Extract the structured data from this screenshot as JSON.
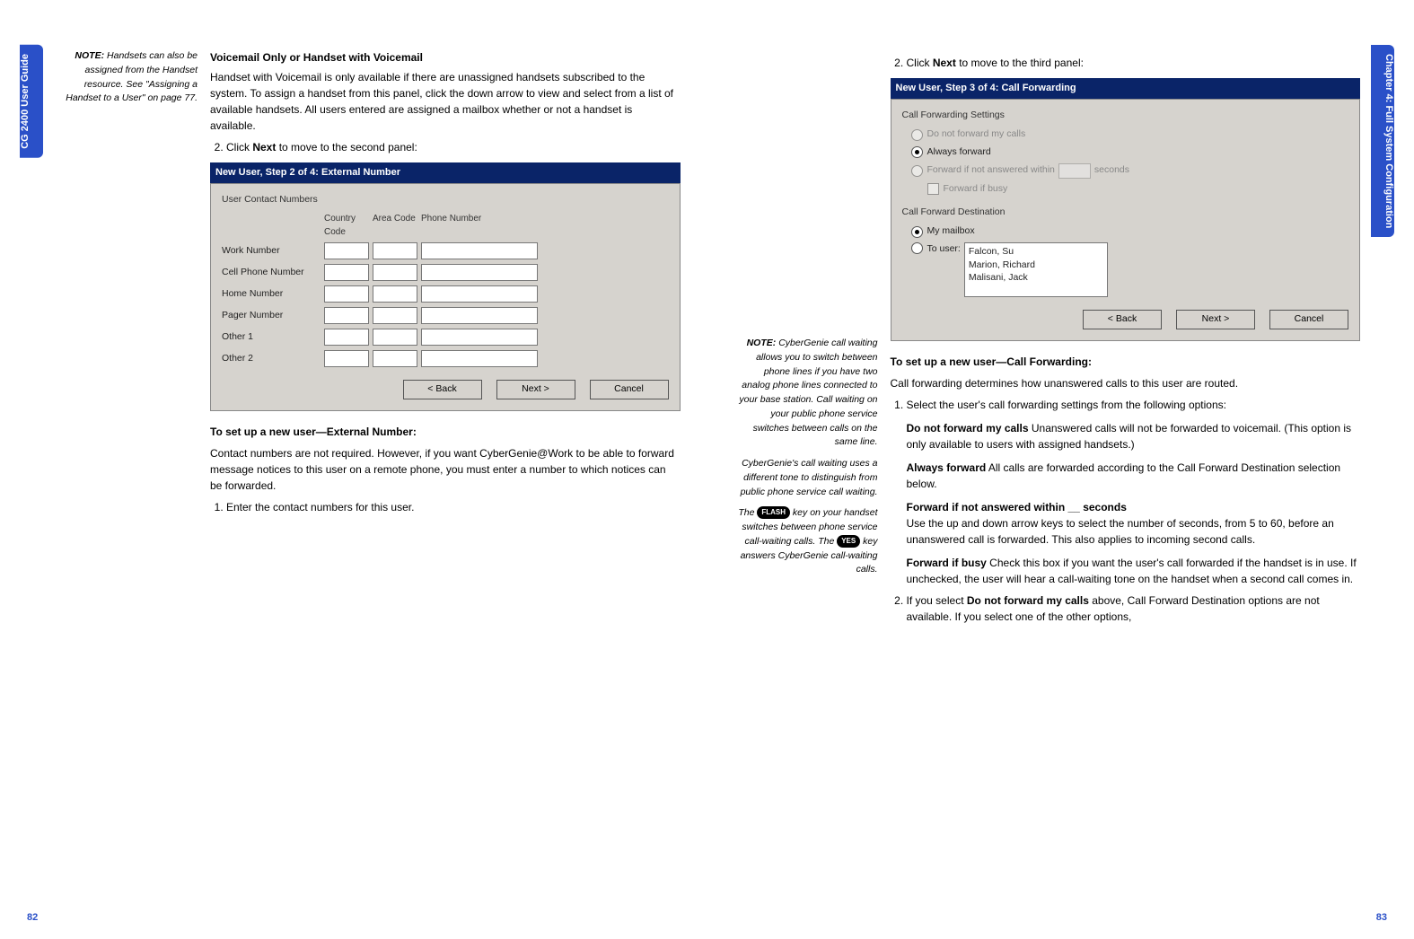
{
  "leftTab": "CG 2400 User Guide",
  "rightTab": "Chapter 4: Full System Configuration",
  "leftPage": {
    "note": {
      "label": "NOTE:",
      "text": "Handsets can also be assigned from the Handset resource. See \"Assigning a Handset to a User\" on page 77."
    },
    "h1": "Voicemail Only or Handset with Voicemail",
    "p1": "Handset with Voicemail is only available if there are unassigned handsets subscribed to the system. To assign a handset from this panel, click the down arrow to view and select from a list of available handsets. All users entered are assigned a mailbox whether or not a handset is available.",
    "step2": "Click ",
    "step2b": "Next",
    "step2c": " to move to the second panel:",
    "dialog1": {
      "title": "New User, Step 2 of 4: External Number",
      "group": "User Contact Numbers",
      "colCountry": "Country Code",
      "colArea": "Area Code",
      "colPhone": "Phone Number",
      "rows": [
        "Work Number",
        "Cell Phone Number",
        "Home Number",
        "Pager Number",
        "Other 1",
        "Other 2"
      ],
      "back": "< Back",
      "next": "Next >",
      "cancel": "Cancel"
    },
    "h2": "To set up a new user—External Number:",
    "p2": "Contact numbers are not required. However, if you want CyberGenie@Work to be able to forward message notices to this user on a remote phone, you must enter a number to which notices can be forwarded.",
    "step1b": "Enter the contact numbers for this user.",
    "pageNum": "82"
  },
  "rightPage": {
    "step2a": "Click ",
    "step2b": "Next",
    "step2c": " to move to the third panel:",
    "dialog2": {
      "title": "New User, Step 3 of 4: Call Forwarding",
      "group1": "Call Forwarding Settings",
      "opt1": "Do not forward my calls",
      "opt2": "Always forward",
      "opt3a": "Forward if not answered within",
      "opt3b": "seconds",
      "opt3chk": "Forward if busy",
      "group2": "Call Forward Destination",
      "opt4": "My mailbox",
      "opt5": "To user:",
      "listItems": [
        "Falcon, Su",
        "Marion, Richard",
        "Malisani, Jack"
      ],
      "back": "< Back",
      "next": "Next >",
      "cancel": "Cancel"
    },
    "note": {
      "label": "NOTE:",
      "text1": "CyberGenie call waiting allows you to switch between phone lines if you have two analog phone lines connected to your base station. Call waiting on your public phone service switches between calls on the same line.",
      "text2": "CyberGenie's call waiting uses a different tone to distinguish from public phone service call waiting.",
      "text3a": "The ",
      "key1": "FLASH",
      "text3b": " key on your handset switches between phone service call-waiting calls. The ",
      "key2": "YES",
      "text3c": " key answers CyberGenie call-waiting calls."
    },
    "h1": "To set up a new user—Call Forwarding:",
    "p1": "Call forwarding determines how unanswered calls to this user are routed.",
    "li1": "Select the user's call forwarding settings from the following options:",
    "d1t": "Do not forward my calls",
    "d1d": "  Unanswered calls will not be forwarded to voicemail. (This option is only available to users with assigned handsets.)",
    "d2t": "Always forward",
    "d2d": "  All calls are forwarded according to the Call Forward Destination selection below.",
    "d3t": "Forward if not answered within __ seconds",
    "d3d": "Use the up and down arrow keys to select the number of seconds, from 5 to 60, before an unanswered call is forwarded. This also applies to incoming second calls.",
    "d4t": "Forward if busy",
    "d4d": "  Check this box if you want the user's call forwarded if the handset is in use. If unchecked, the user will hear a call-waiting tone on the handset when a second call comes in.",
    "li2a": "If you select ",
    "li2b": "Do not forward my calls",
    "li2c": " above, Call Forward Destination options are not available. If you select one of the other options,",
    "pageNum": "83"
  }
}
